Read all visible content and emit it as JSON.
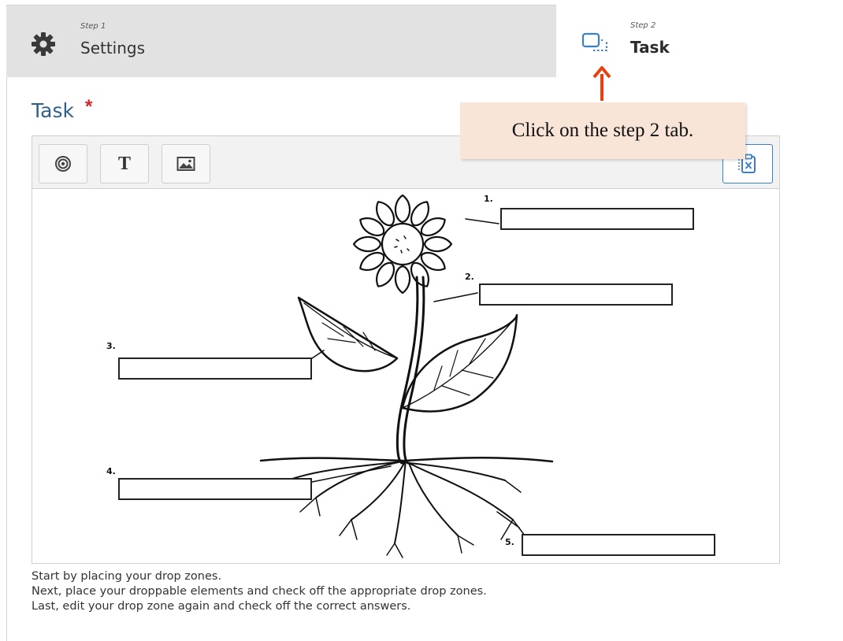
{
  "tabs": {
    "settings": {
      "step": "Step 1",
      "name": "Settings",
      "icon": "gear-icon"
    },
    "task": {
      "step": "Step 2",
      "name": "Task",
      "icon": "drop-zone-icon"
    }
  },
  "section": {
    "title": "Task",
    "required_mark": "*"
  },
  "toolbar": {
    "target_icon": "target-icon",
    "text_label": "T",
    "image_icon": "image-icon",
    "clear_icon": "clipboard-clear-icon"
  },
  "callout": {
    "text": "Click on the step 2 tab.",
    "arrow_color": "#e8400f",
    "bg_color": "#f9e4d8"
  },
  "diagram": {
    "labels": [
      "1.",
      "2.",
      "3.",
      "4.",
      "5."
    ]
  },
  "instructions": [
    "Start by placing your drop zones.",
    "Next, place your droppable elements and check off the appropriate drop zones.",
    "Last, edit your drop zone again and check off the correct answers."
  ],
  "colors": {
    "title": "#2f5f8a",
    "required": "#d9232a",
    "accent": "#3b7fc4"
  }
}
